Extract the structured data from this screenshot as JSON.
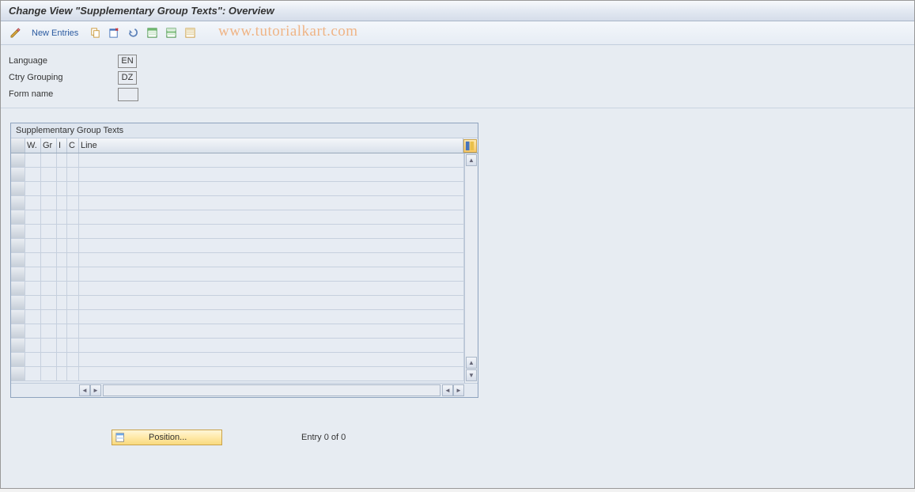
{
  "title": "Change View \"Supplementary Group Texts\": Overview",
  "toolbar": {
    "new_entries_label": "New Entries"
  },
  "watermark": "www.tutorialkart.com",
  "fields": {
    "language_label": "Language",
    "language_value": "EN",
    "ctry_grouping_label": "Ctry Grouping",
    "ctry_grouping_value": "DZ",
    "form_name_label": "Form name",
    "form_name_value": ""
  },
  "table": {
    "title": "Supplementary Group Texts",
    "columns": {
      "w": "W.",
      "gr": "Gr",
      "i": "I",
      "c": "C",
      "line": "Line"
    },
    "rows": []
  },
  "footer": {
    "position_label": "Position...",
    "entry_text": "Entry 0 of 0"
  }
}
